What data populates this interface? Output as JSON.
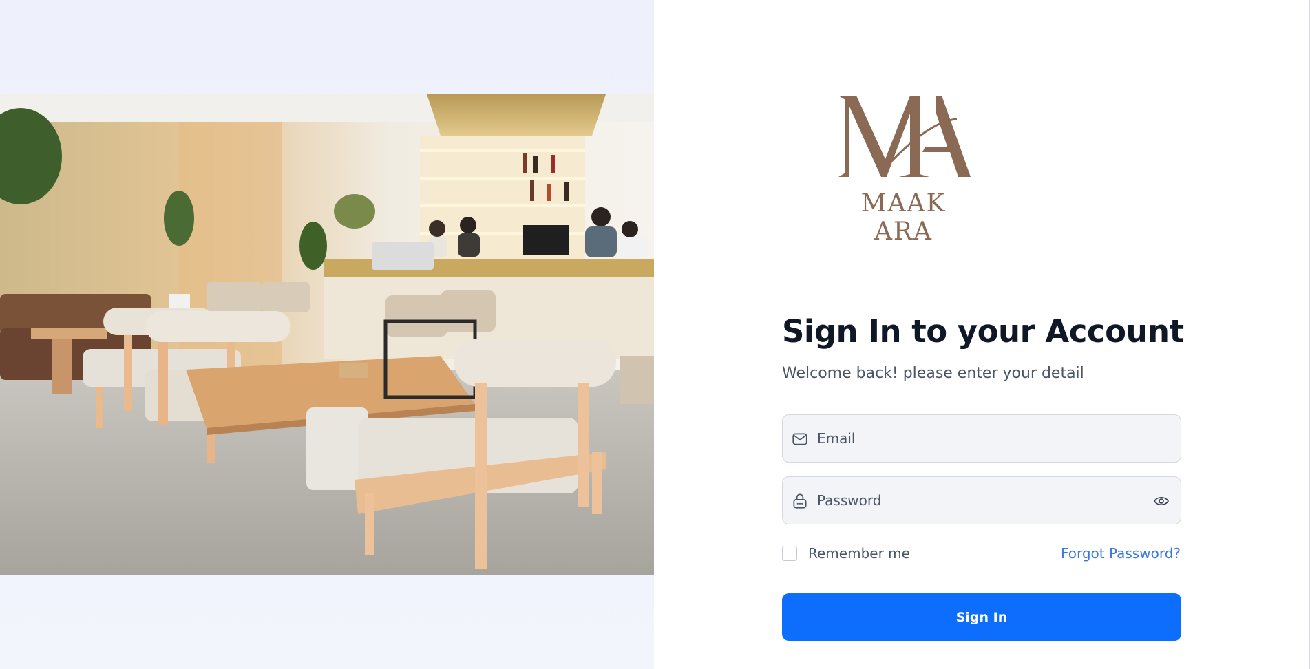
{
  "brand": {
    "logo_text": "MAAK ARA",
    "color": "#8a6a55"
  },
  "hero_image": {
    "alt": "Cafe interior with wooden sofas, tables and a bar counter"
  },
  "form": {
    "title": "Sign In to your Account",
    "subtitle": "Welcome back! please enter your detail",
    "email_placeholder": "Email",
    "password_placeholder": "Password",
    "remember_label": "Remember me",
    "remember_checked": false,
    "forgot_label": "Forgot Password?",
    "submit_label": "Sign In"
  },
  "icons": {
    "email": "mail-icon",
    "password": "lock-icon",
    "toggle": "eye-icon"
  },
  "colors": {
    "accent": "#0d6efd",
    "link": "#3a78e0",
    "left_bg": "#eef0fb",
    "input_bg": "#f3f4f7"
  }
}
